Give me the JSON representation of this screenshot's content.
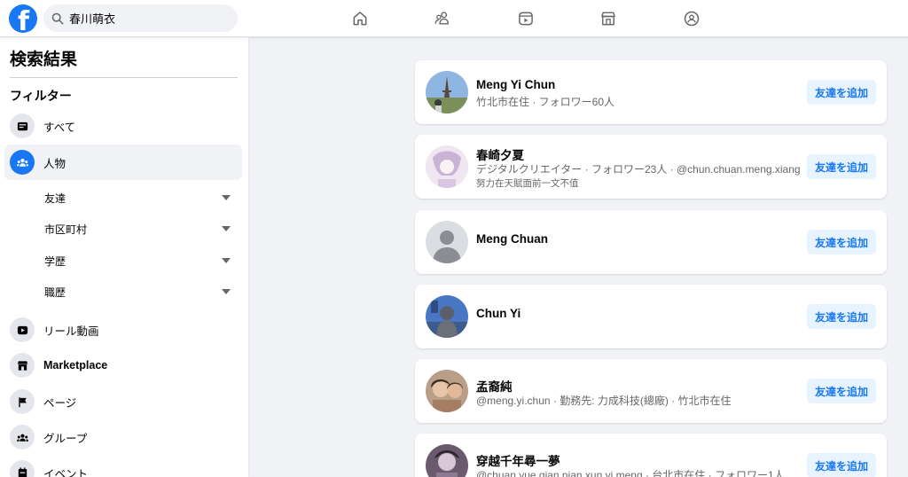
{
  "search": {
    "query": "春川萌衣"
  },
  "nav": {
    "icons": [
      "home-icon",
      "friends-icon",
      "watch-icon",
      "marketplace-icon",
      "groups-icon"
    ]
  },
  "sidebar": {
    "title": "検索結果",
    "filter_title": "フィルター",
    "items": [
      {
        "label": "すべて",
        "icon": "all-icon",
        "active": false
      },
      {
        "label": "人物",
        "icon": "people-icon",
        "active": true
      },
      {
        "label": "リール動画",
        "icon": "reels-icon",
        "active": false
      },
      {
        "label": "Marketplace",
        "icon": "marketplace-icon",
        "active": false
      },
      {
        "label": "ページ",
        "icon": "flag-icon",
        "active": false
      },
      {
        "label": "グループ",
        "icon": "groups-icon",
        "active": false
      },
      {
        "label": "イベント",
        "icon": "calendar-icon",
        "active": false
      }
    ],
    "people_filters": [
      "友達",
      "市区町村",
      "学歴",
      "職歴"
    ]
  },
  "results": [
    {
      "name": "Meng Yi Chun",
      "meta": "竹北市在住 · フォロワー60人",
      "extra": "",
      "button": "友達を追加"
    },
    {
      "name": "春崎夕夏",
      "meta": "デジタルクリエイター · フォロワー23人 · @chun.chuan.meng.xiang",
      "extra": "努力在天賦面前一文不值",
      "button": "友達を追加"
    },
    {
      "name": "Meng Chuan",
      "meta": "",
      "extra": "",
      "button": "友達を追加"
    },
    {
      "name": "Chun Yi",
      "meta": "",
      "extra": "",
      "button": "友達を追加"
    },
    {
      "name": "孟裔純",
      "meta": "@meng.yi.chun · 勤務先: 力成科技(總廠) · 竹北市在住",
      "extra": "",
      "button": "友達を追加"
    },
    {
      "name": "穿越千年尋一夢",
      "meta": "@chuan.yue.qian.nian.xun.yi.meng · 台北市在住 · フォロワー1人",
      "extra": "",
      "button": "友達を追加"
    }
  ],
  "colors": {
    "brand": "#1877f2",
    "button_bg": "#e7f3ff",
    "background": "#f0f2f5"
  }
}
